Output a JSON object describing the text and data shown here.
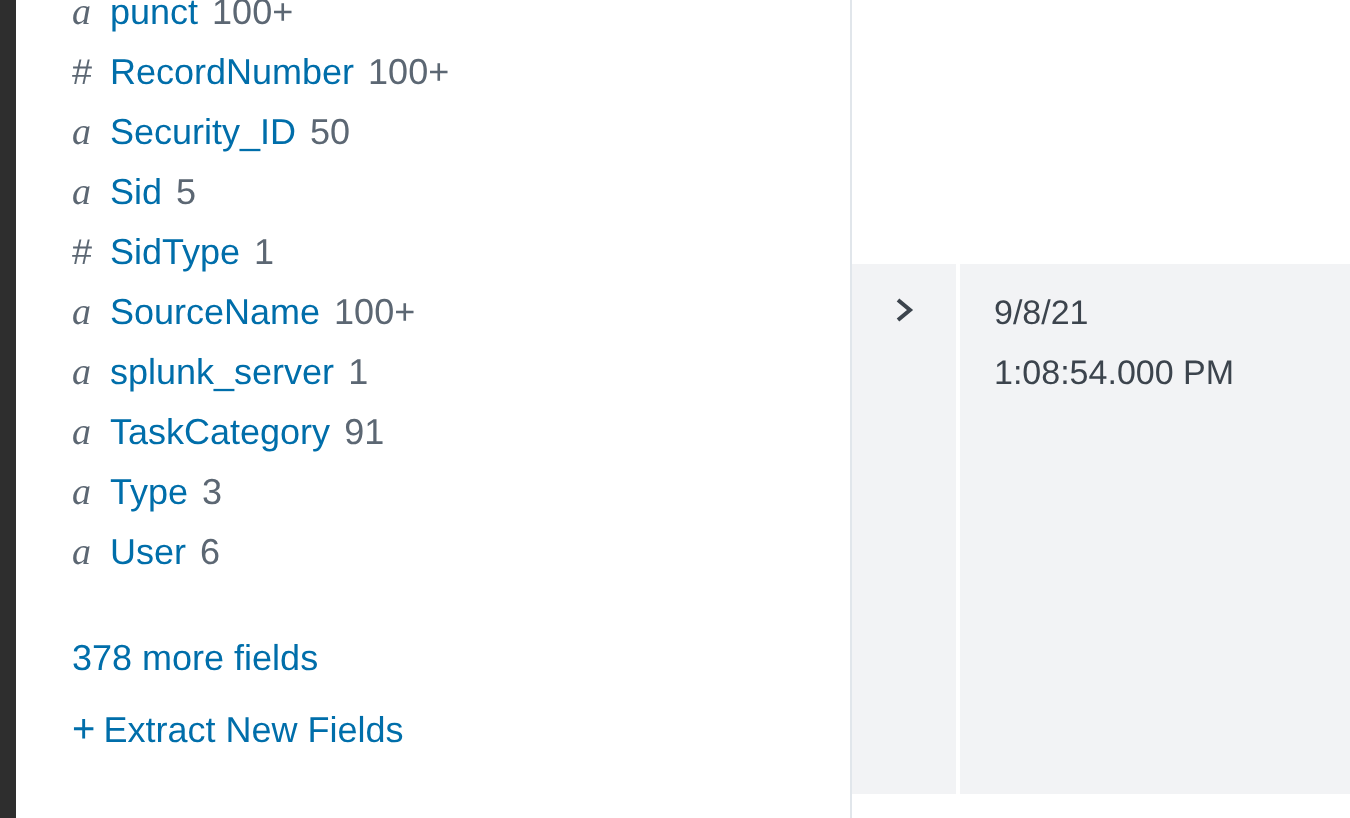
{
  "fields": [
    {
      "kind": "string",
      "type_icon": "a",
      "name": "punct",
      "count": "100+"
    },
    {
      "kind": "number",
      "type_icon": "#",
      "name": "RecordNumber",
      "count": "100+"
    },
    {
      "kind": "string",
      "type_icon": "a",
      "name": "Security_ID",
      "count": "50"
    },
    {
      "kind": "string",
      "type_icon": "a",
      "name": "Sid",
      "count": "5"
    },
    {
      "kind": "number",
      "type_icon": "#",
      "name": "SidType",
      "count": "1"
    },
    {
      "kind": "string",
      "type_icon": "a",
      "name": "SourceName",
      "count": "100+"
    },
    {
      "kind": "string",
      "type_icon": "a",
      "name": "splunk_server",
      "count": "1"
    },
    {
      "kind": "string",
      "type_icon": "a",
      "name": "TaskCategory",
      "count": "91"
    },
    {
      "kind": "string",
      "type_icon": "a",
      "name": "Type",
      "count": "3"
    },
    {
      "kind": "string",
      "type_icon": "a",
      "name": "User",
      "count": "6"
    }
  ],
  "more_fields_link": "378 more fields",
  "extract_link": {
    "icon": "+",
    "label": "Extract New Fields"
  },
  "events": [
    {
      "date": "9/8/21",
      "time": "1:08:54.000 PM",
      "expanded": false
    }
  ]
}
